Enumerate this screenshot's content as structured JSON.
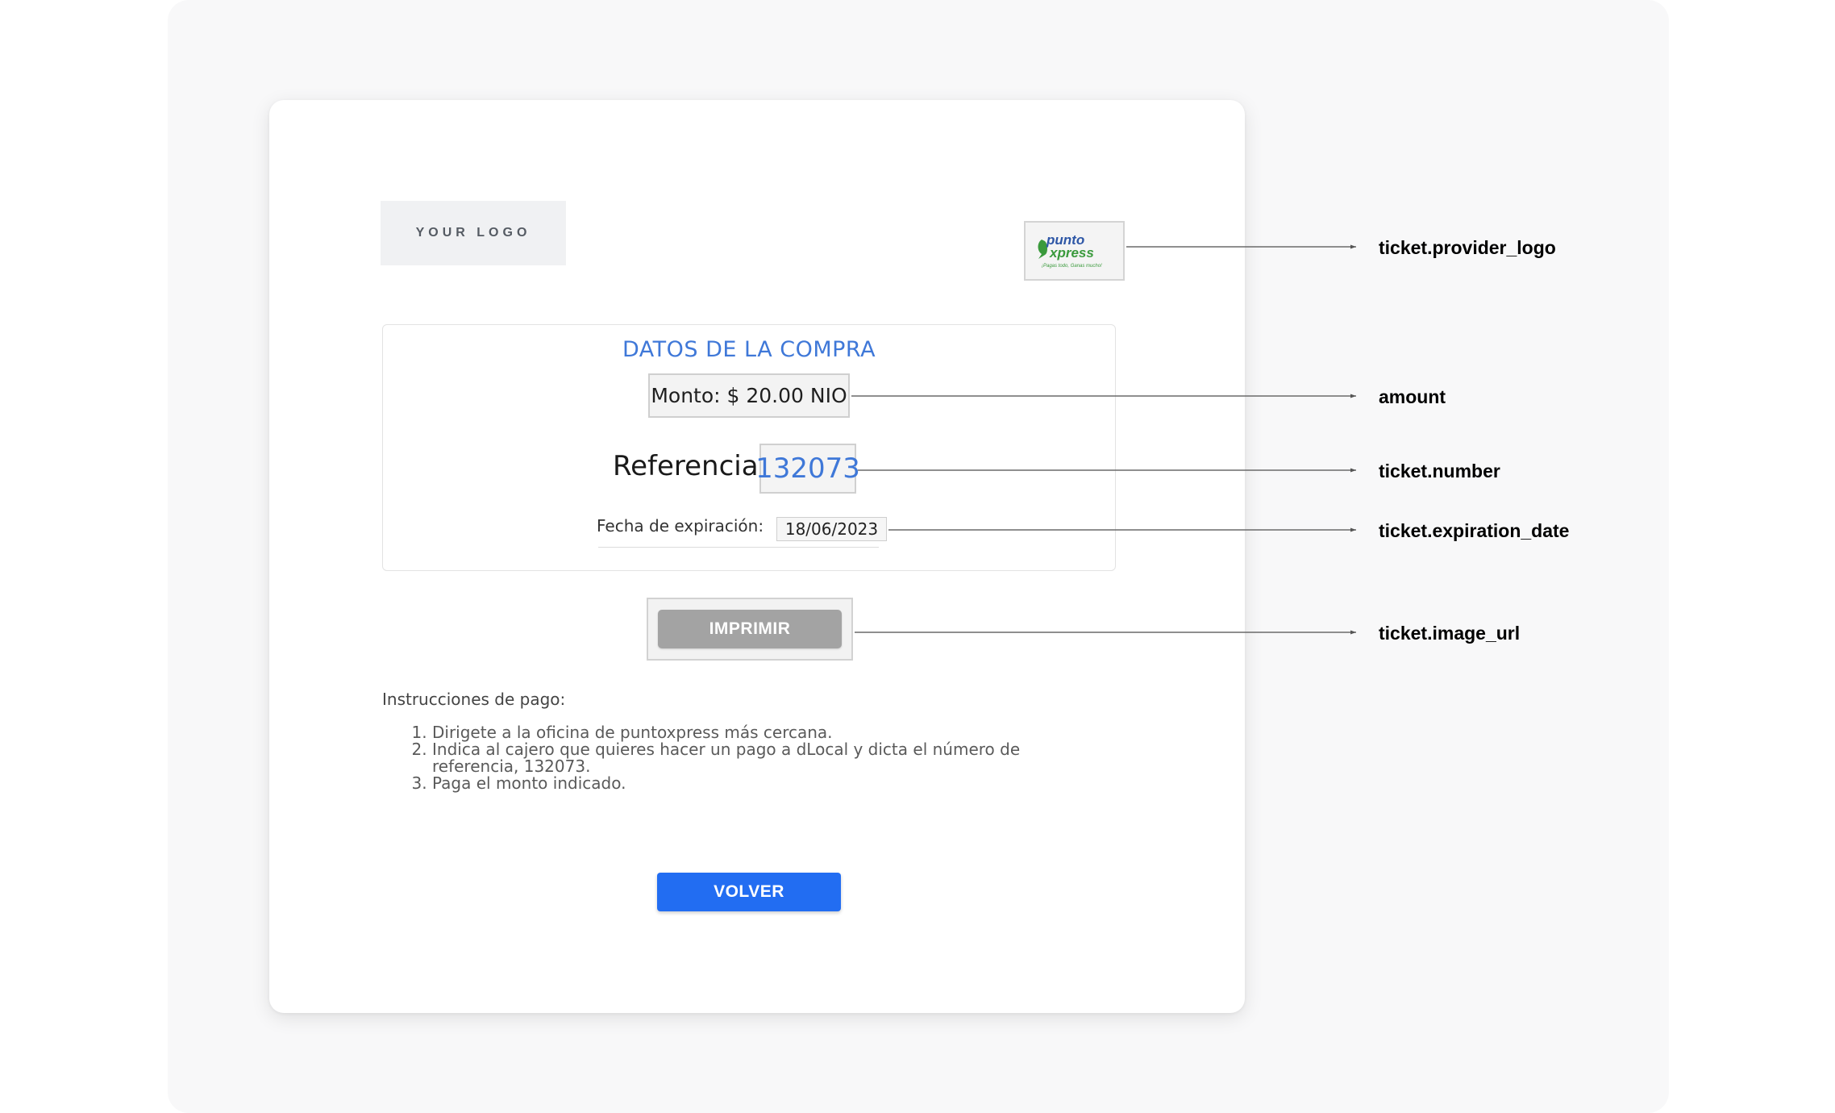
{
  "merchant_logo": {
    "text": "YOUR LOGO"
  },
  "provider_logo": {
    "brand_top": "punto",
    "brand_bottom": "xpress",
    "tagline": "¡Pagas todo, Ganas mucho!",
    "colors": {
      "blue": "#2e57a6",
      "green": "#3a9a3c"
    }
  },
  "purchase": {
    "title": "DATOS DE LA COMPRA",
    "amount_text": "Monto: $ 20.00 NIO",
    "reference_label": "Referencia:",
    "reference_value": "132073",
    "expiration_label": "Fecha de expiración:",
    "expiration_value": "18/06/2023"
  },
  "print_button_label": "IMPRIMIR",
  "instructions": {
    "heading": "Instrucciones de pago:",
    "steps": [
      "Dirigete a la oficina de puntoxpress más cercana.",
      "Indica al cajero que quieres hacer un pago a dLocal y dicta el número de referencia, 132073.",
      "Paga el monto indicado."
    ]
  },
  "back_button_label": "VOLVER",
  "annotations": [
    "ticket.provider_logo",
    "amount",
    "ticket.number",
    "ticket.expiration_date",
    "ticket.image_url"
  ],
  "colors": {
    "accent_blue": "#3f78d8",
    "primary_button": "#226df2",
    "disabled_button": "#a3a3a3"
  }
}
